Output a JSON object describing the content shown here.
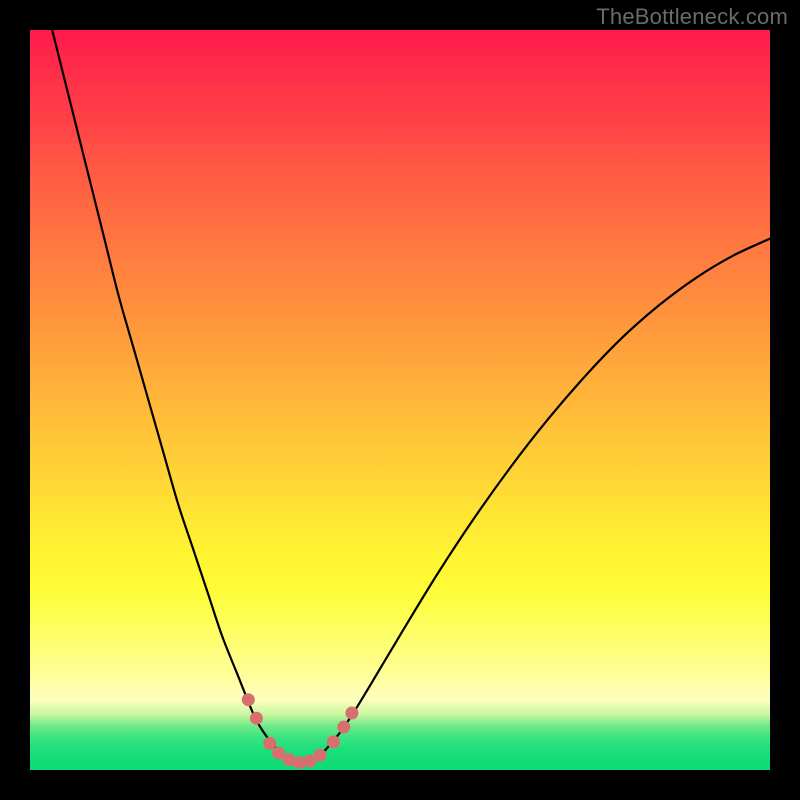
{
  "attribution": "TheBottleneck.com",
  "accent_colors": {
    "curve": "#000000",
    "marker_fill": "#d96e6e",
    "marker_stroke": "#b94f4f",
    "gradient_top": "#ff1a4b",
    "gradient_bottom": "#0fdc76"
  },
  "chart_data": {
    "type": "line",
    "title": "",
    "xlabel": "",
    "ylabel": "",
    "xlim": [
      0,
      100
    ],
    "ylim": [
      0,
      100
    ],
    "grid": false,
    "legend": false,
    "series": [
      {
        "name": "bottleneck-curve",
        "x": [
          0,
          2,
          4,
          6,
          8,
          10,
          12,
          14,
          16,
          18,
          20,
          22,
          24,
          26,
          28,
          30,
          31,
          32,
          33,
          34,
          35,
          36,
          37,
          38,
          39,
          40,
          42,
          44,
          46,
          50,
          55,
          60,
          65,
          70,
          75,
          80,
          85,
          90,
          95,
          100
        ],
        "y": [
          112,
          104,
          96,
          88,
          80,
          72,
          64,
          57,
          50,
          43,
          36,
          30,
          24,
          18,
          13,
          8,
          6,
          4.5,
          3.2,
          2.2,
          1.5,
          1.1,
          1.0,
          1.2,
          1.8,
          2.8,
          5.2,
          8.2,
          11.5,
          18.2,
          26.4,
          34.0,
          41.0,
          47.4,
          53.2,
          58.4,
          62.8,
          66.5,
          69.5,
          71.8
        ]
      }
    ],
    "markers": [
      {
        "x": 29.5,
        "y": 9.5
      },
      {
        "x": 30.6,
        "y": 7.0
      },
      {
        "x": 32.4,
        "y": 3.6
      },
      {
        "x": 33.6,
        "y": 2.3
      },
      {
        "x": 35.0,
        "y": 1.4
      },
      {
        "x": 36.4,
        "y": 1.0
      },
      {
        "x": 37.8,
        "y": 1.2
      },
      {
        "x": 39.2,
        "y": 2.0
      },
      {
        "x": 41.0,
        "y": 3.8
      },
      {
        "x": 42.4,
        "y": 5.8
      },
      {
        "x": 43.5,
        "y": 7.7
      }
    ]
  }
}
